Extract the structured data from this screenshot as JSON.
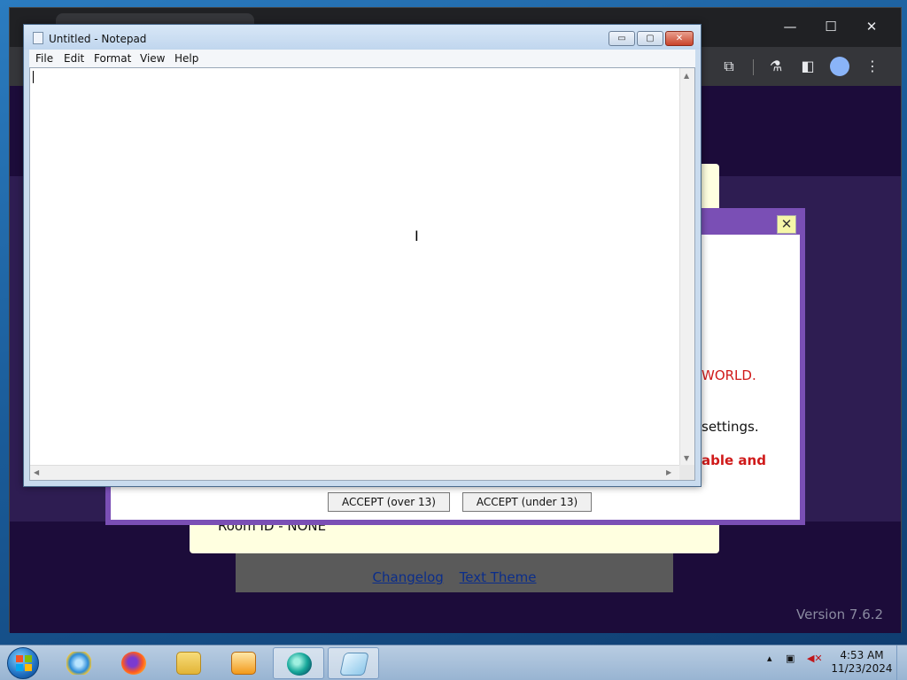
{
  "notepad": {
    "title": "Untitled - Notepad",
    "menus": [
      "File",
      "Edit",
      "Format",
      "View",
      "Help"
    ],
    "content": "",
    "buttons": {
      "minimize": "▭",
      "maximize": "▢",
      "close": "✕"
    }
  },
  "browser": {
    "controls": {
      "minimize": "—",
      "maximize": "☐",
      "close": "✕"
    }
  },
  "webpage": {
    "modal_fragments": {
      "world": "WORLD.",
      "settings": "settings.",
      "able_and": "able and"
    },
    "accept_over": "ACCEPT (over 13)",
    "accept_under": "ACCEPT (under 13)",
    "close_label": "✕",
    "room_id": "Room ID - NONE",
    "links": [
      "Changelog",
      "Text Theme"
    ],
    "version": "Version 7.6.2"
  },
  "taskbar": {
    "items": [
      {
        "name": "internet-explorer",
        "active": false
      },
      {
        "name": "firefox",
        "active": false
      },
      {
        "name": "file-explorer",
        "active": false
      },
      {
        "name": "media-player",
        "active": false
      },
      {
        "name": "browser-app",
        "active": true
      },
      {
        "name": "notepad",
        "active": true
      }
    ],
    "time": "4:53 AM",
    "date": "11/23/2024"
  },
  "colors": {
    "accent_purple": "#7a4fb5",
    "warning_red": "#d01a1a",
    "link_blue": "#0b2d8a"
  }
}
